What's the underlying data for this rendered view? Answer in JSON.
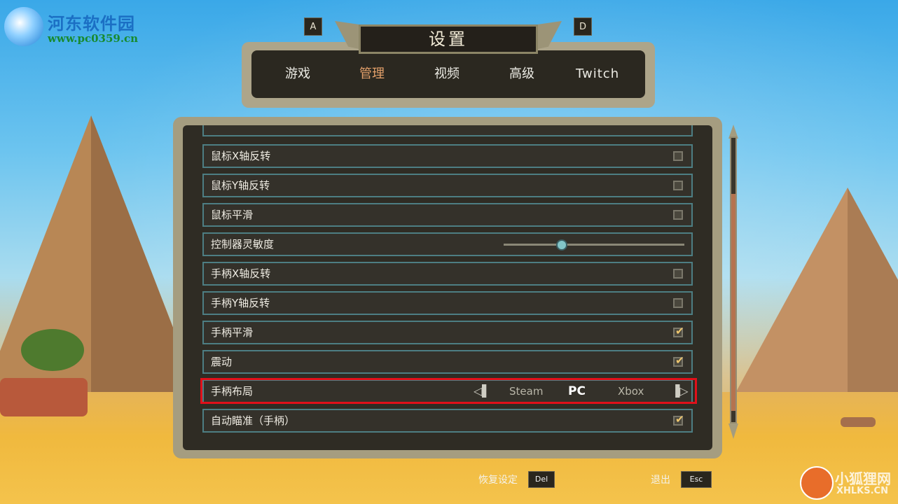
{
  "watermarks": {
    "top_left_title": "河东软件园",
    "top_left_url": "www.pc0359.cn",
    "bottom_right_title": "小狐狸网",
    "bottom_right_sub": "XHLKS.CN"
  },
  "header": {
    "title": "设置",
    "prev_key": "A",
    "next_key": "D",
    "tabs": [
      {
        "label": "游戏",
        "active": false
      },
      {
        "label": "管理",
        "active": true
      },
      {
        "label": "视频",
        "active": false
      },
      {
        "label": "高级",
        "active": false
      },
      {
        "label": "Twitch",
        "active": false
      }
    ]
  },
  "settings": [
    {
      "label": "鼠标X轴反转",
      "type": "checkbox",
      "checked": false
    },
    {
      "label": "鼠标Y轴反转",
      "type": "checkbox",
      "checked": false
    },
    {
      "label": "鼠标平滑",
      "type": "checkbox",
      "checked": false
    },
    {
      "label": "控制器灵敏度",
      "type": "slider",
      "value": 0.32
    },
    {
      "label": "手柄X轴反转",
      "type": "checkbox",
      "checked": false
    },
    {
      "label": "手柄Y轴反转",
      "type": "checkbox",
      "checked": false
    },
    {
      "label": "手柄平滑",
      "type": "checkbox",
      "checked": true
    },
    {
      "label": "震动",
      "type": "checkbox",
      "checked": true
    },
    {
      "label": "手柄布局",
      "type": "selector",
      "options": [
        "Steam",
        "PC",
        "Xbox"
      ],
      "selected": "PC"
    },
    {
      "label": "自动瞄准（手柄）",
      "type": "checkbox",
      "checked": true
    }
  ],
  "scrollbar": {
    "position": 0.2
  },
  "footer": {
    "reset_label": "恢复设定",
    "reset_key": "Del",
    "exit_label": "退出",
    "exit_key": "Esc"
  },
  "colors": {
    "active_tab": "#e3a06a",
    "highlight": "#e0101a",
    "checkmark": "#efc76e",
    "row_border": "#4d7e83"
  }
}
